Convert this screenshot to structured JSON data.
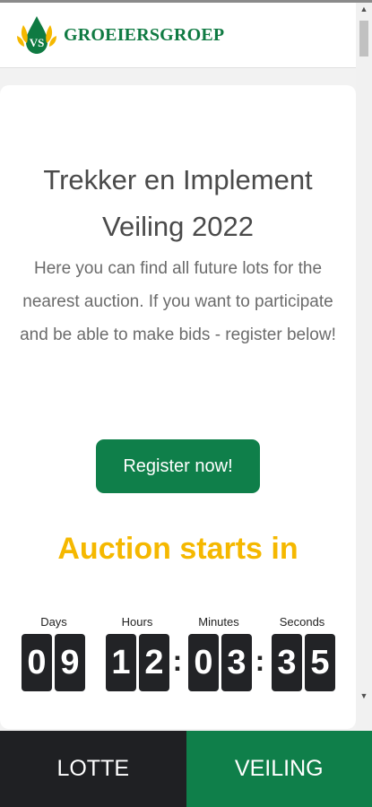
{
  "header": {
    "logo_monogram": "VS",
    "logo_text": "GROEIERSGROEP"
  },
  "main": {
    "title_line1": "Trekker en Implement",
    "title_line2": "Veiling 2022",
    "description": "Here you can find all future lots for the nearest auction. If you want to participate and be able to make bids - register below!",
    "register_label": "Register now!",
    "auction_starts": "Auction starts in"
  },
  "countdown": {
    "labels": {
      "days": "Days",
      "hours": "Hours",
      "minutes": "Minutes",
      "seconds": "Seconds"
    },
    "digits": {
      "d1": "0",
      "d2": "9",
      "h1": "1",
      "h2": "2",
      "m1": "0",
      "m2": "3",
      "s1": "3",
      "s2": "5"
    },
    "separator": ":"
  },
  "tabs": {
    "lotte": "LOTTE",
    "veiling": "VEILING"
  },
  "colors": {
    "brand_green": "#0f7f4a",
    "accent_yellow": "#f5b800",
    "dark": "#1f2023"
  }
}
